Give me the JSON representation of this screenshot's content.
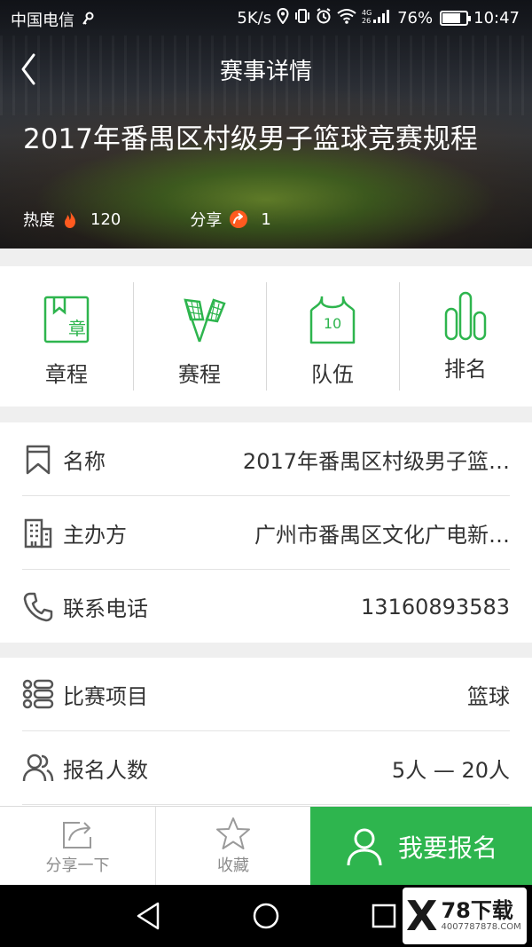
{
  "status_bar": {
    "carrier": "中国电信",
    "speed": "5K/s",
    "network": "4G",
    "battery": "76%",
    "battery_level": 0.76,
    "time": "10:47"
  },
  "header": {
    "title": "赛事详情",
    "back_icon": "chevron-left-icon"
  },
  "event": {
    "title": "2017年番禺区村级男子篮球竞赛规程",
    "heat_label": "热度",
    "heat_value": "120",
    "share_label": "分享",
    "share_value": "1"
  },
  "quick_menu": [
    {
      "label": "章程",
      "icon": "rules-bookmark-icon",
      "icon_text": "章"
    },
    {
      "label": "赛程",
      "icon": "flags-icon"
    },
    {
      "label": "队伍",
      "icon": "jersey-icon",
      "icon_text": "10"
    },
    {
      "label": "排名",
      "icon": "bar-chart-icon"
    }
  ],
  "info": [
    {
      "label": "名称",
      "value": "2017年番禺区村级男子篮…",
      "icon": "bookmark-icon"
    },
    {
      "label": "主办方",
      "value": "广州市番禺区文化广电新…",
      "icon": "building-icon"
    },
    {
      "label": "联系电话",
      "value": "13160893583",
      "icon": "phone-icon"
    }
  ],
  "details": [
    {
      "label": "比赛项目",
      "value": "篮球",
      "icon": "list-icon"
    },
    {
      "label": "报名人数",
      "value": "5人 — 20人",
      "icon": "people-icon"
    }
  ],
  "bottom_bar": {
    "share_label": "分享一下",
    "favorite_label": "收藏",
    "signup_label": "我要报名"
  },
  "watermark": {
    "brand": "78下载",
    "url": "4007787878.COM"
  },
  "colors": {
    "accent": "#2eb54e",
    "hot": "#ff5a1f"
  }
}
